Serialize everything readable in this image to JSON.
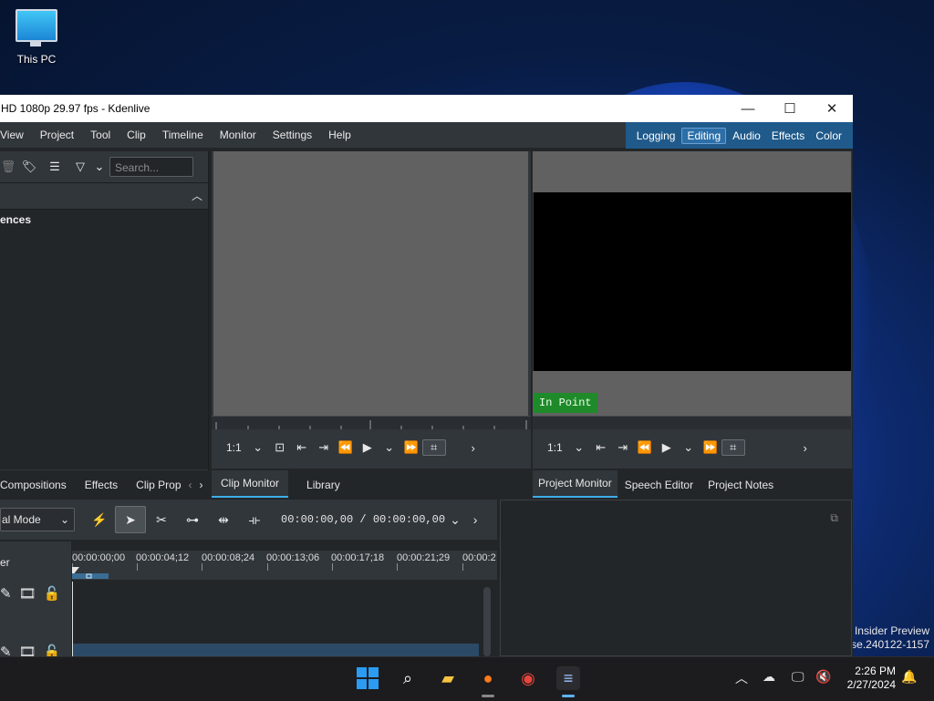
{
  "desktop": {
    "icon_label": "This PC",
    "watermark_line1": "Insider Preview",
    "watermark_line2": "ase.240122-1157"
  },
  "window": {
    "title": "HD 1080p 29.97 fps - Kdenlive",
    "controls": {
      "minimize": "—",
      "maximize": "☐",
      "close": "✕"
    }
  },
  "menu": {
    "items": [
      "View",
      "Project",
      "Tool",
      "Clip",
      "Timeline",
      "Monitor",
      "Settings",
      "Help"
    ]
  },
  "layouts": {
    "items": [
      "Logging",
      "Editing",
      "Audio",
      "Effects",
      "Color"
    ],
    "active": "Editing"
  },
  "bin": {
    "search_placeholder": "Search...",
    "list_item": "ences"
  },
  "clip_monitor": {
    "zoom": "1:1"
  },
  "project_monitor": {
    "zoom": "1:1",
    "in_point_label": "In Point"
  },
  "tabs_left": [
    "Compositions",
    "Effects",
    "Clip Prop"
  ],
  "tabs_mid": [
    "Clip Monitor",
    "Library"
  ],
  "tabs_right": [
    "Project Monitor",
    "Speech Editor",
    "Project Notes"
  ],
  "timeline": {
    "mode": "al Mode",
    "timecode": "00:00:00,00 / 00:00:00,00",
    "header_label": "er",
    "ruler_ticks": [
      "00:00:00;00",
      "00:00:04;12",
      "00:00:08;24",
      "00:00:13;06",
      "00:00:17;18",
      "00:00:21;29",
      "00:00:2"
    ]
  },
  "taskbar": {
    "time": "2:26 PM",
    "date": "2/27/2024"
  },
  "colors": {
    "accent": "#3daee9",
    "layout_bar": "#1f5a8b",
    "in_point": "#1f8a2a"
  }
}
